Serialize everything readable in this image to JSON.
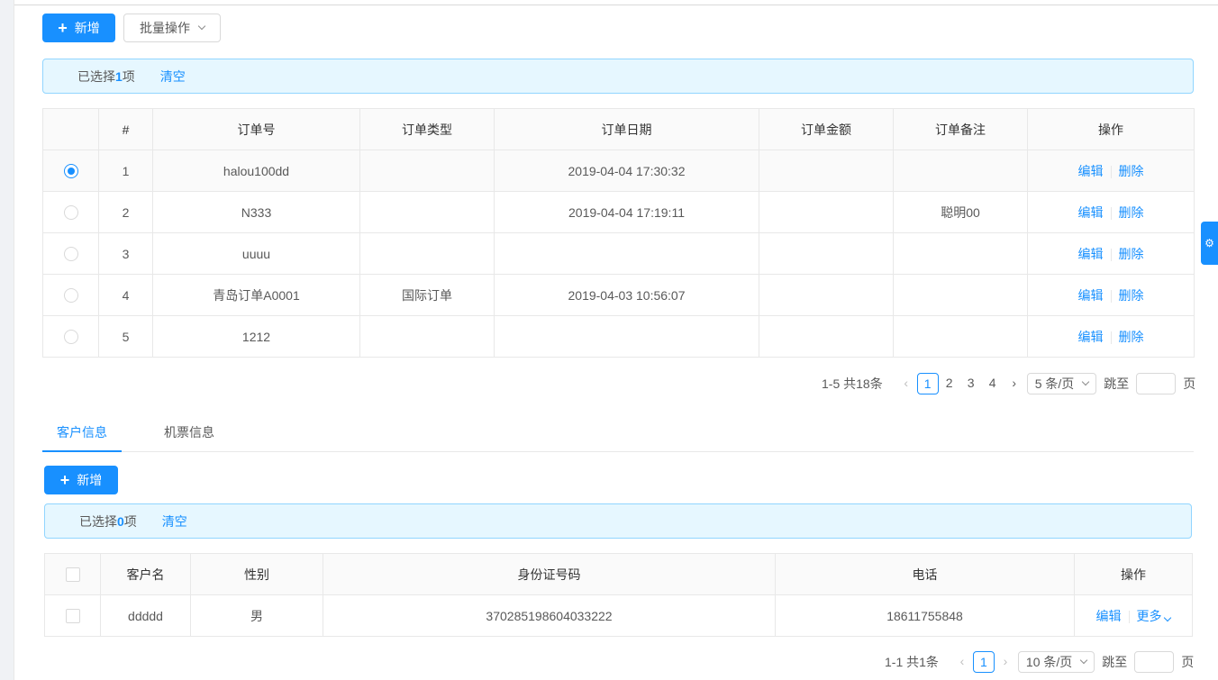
{
  "toolbar": {
    "add_label": "新增",
    "batch_label": "批量操作"
  },
  "alert1": {
    "prefix": "已选择",
    "count": "1",
    "suffix": "项",
    "clear": "清空"
  },
  "orders": {
    "columns": [
      "#",
      "订单号",
      "订单类型",
      "订单日期",
      "订单金额",
      "订单备注",
      "操作"
    ],
    "rows": [
      {
        "index": "1",
        "no": "halou100dd",
        "type": "",
        "date": "2019-04-04 17:30:32",
        "amount": "",
        "remark": "",
        "selected": true
      },
      {
        "index": "2",
        "no": "N333",
        "type": "",
        "date": "2019-04-04 17:19:11",
        "amount": "",
        "remark": "聪明00",
        "selected": false
      },
      {
        "index": "3",
        "no": "uuuu",
        "type": "",
        "date": "",
        "amount": "",
        "remark": "",
        "selected": false
      },
      {
        "index": "4",
        "no": "青岛订单A0001",
        "type": "国际订单",
        "date": "2019-04-03 10:56:07",
        "amount": "",
        "remark": "",
        "selected": false
      },
      {
        "index": "5",
        "no": "1212",
        "type": "",
        "date": "",
        "amount": "",
        "remark": "",
        "selected": false
      }
    ],
    "edit_label": "编辑",
    "delete_label": "删除"
  },
  "pager1": {
    "total": "1-5 共18条",
    "pages": [
      "1",
      "2",
      "3",
      "4"
    ],
    "current": "1",
    "size": "5 条/页",
    "jump": "跳至",
    "page_unit": "页"
  },
  "tabs": [
    "客户信息",
    "机票信息"
  ],
  "sub": {
    "add_label": "新增"
  },
  "alert2": {
    "prefix": "已选择",
    "count": "0",
    "suffix": "项",
    "clear": "清空"
  },
  "customers": {
    "columns": [
      "客户名",
      "性别",
      "身份证号码",
      "电话",
      "操作"
    ],
    "rows": [
      {
        "name": "ddddd",
        "gender": "男",
        "id_no": "370285198604033222",
        "phone": "18611755848"
      }
    ],
    "edit_label": "编辑",
    "more_label": "更多"
  },
  "pager2": {
    "total": "1-1 共1条",
    "current": "1",
    "size": "10 条/页",
    "jump": "跳至",
    "page_unit": "页"
  },
  "colors": {
    "primary": "#1890ff",
    "alert_bg": "#e6f7ff",
    "alert_border": "#91d5ff"
  }
}
